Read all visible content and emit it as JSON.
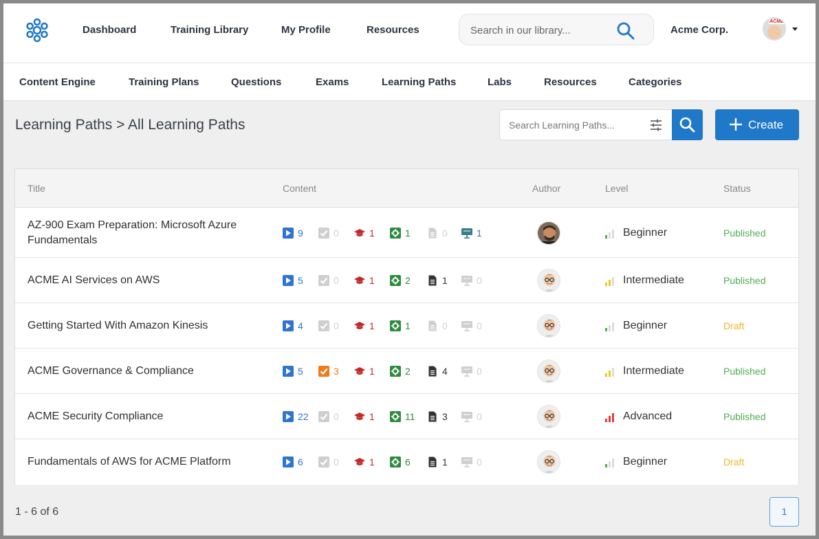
{
  "topnav": {
    "items": [
      "Dashboard",
      "Training Library",
      "My Profile",
      "Resources"
    ],
    "search_placeholder": "Search in our library...",
    "org": "Acme Corp.",
    "avatar_tag": "ACME"
  },
  "subnav": {
    "items": [
      "Content Engine",
      "Training Plans",
      "Questions",
      "Exams",
      "Learning Paths",
      "Labs",
      "Resources",
      "Categories"
    ]
  },
  "page": {
    "title": "Learning Paths > All Learning Paths",
    "search_placeholder": "Search Learning Paths...",
    "create_label": "Create"
  },
  "table": {
    "headers": [
      "Title",
      "Content",
      "Author",
      "Level",
      "Status"
    ],
    "rows": [
      {
        "title": "AZ-900 Exam Preparation: Microsoft Azure Fundamentals",
        "videos": "9",
        "checks": "0",
        "exams": "1",
        "labs": "1",
        "docs": "0",
        "presentations": "1",
        "level": "Beginner",
        "status": "Published"
      },
      {
        "title": "ACME AI Services on AWS",
        "videos": "5",
        "checks": "0",
        "exams": "1",
        "labs": "2",
        "docs": "1",
        "presentations": "0",
        "level": "Intermediate",
        "status": "Published"
      },
      {
        "title": "Getting Started With Amazon Kinesis",
        "videos": "4",
        "checks": "0",
        "exams": "1",
        "labs": "1",
        "docs": "0",
        "presentations": "0",
        "level": "Beginner",
        "status": "Draft"
      },
      {
        "title": "ACME Governance & Compliance",
        "videos": "5",
        "checks": "3",
        "exams": "1",
        "labs": "2",
        "docs": "4",
        "presentations": "0",
        "level": "Intermediate",
        "status": "Published"
      },
      {
        "title": "ACME Security Compliance",
        "videos": "22",
        "checks": "0",
        "exams": "1",
        "labs": "11",
        "docs": "3",
        "presentations": "0",
        "level": "Advanced",
        "status": "Published"
      },
      {
        "title": "Fundamentals of AWS for ACME Platform",
        "videos": "6",
        "checks": "0",
        "exams": "1",
        "labs": "6",
        "docs": "1",
        "presentations": "0",
        "level": "Beginner",
        "status": "Draft"
      }
    ]
  },
  "pagination": {
    "info": "1 - 6 of 6",
    "current_page": "1"
  },
  "colors": {
    "primary": "#1f78c8",
    "published": "#4caf50",
    "draft": "#f0b429",
    "video": "#2f74d0",
    "exam": "#c62828",
    "lab": "#2e8b3e",
    "check_active": "#f07a1a",
    "presentation": "#3a7d8c",
    "inactive": "#cfcfcf"
  }
}
